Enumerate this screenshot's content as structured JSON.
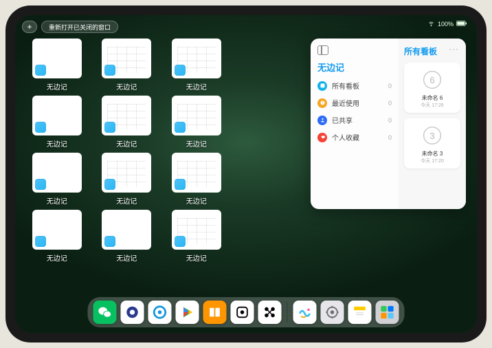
{
  "status": {
    "carrier": "",
    "battery": "100%"
  },
  "top": {
    "plus_label": "+",
    "reopen_label": "重新打开已关闭的窗口"
  },
  "app_label": "无边记",
  "thumbs": [
    {
      "variant": "blank"
    },
    {
      "variant": "cal"
    },
    {
      "variant": "cal"
    },
    null,
    {
      "variant": "blank"
    },
    {
      "variant": "cal"
    },
    {
      "variant": "cal"
    },
    null,
    {
      "variant": "blank"
    },
    {
      "variant": "cal"
    },
    {
      "variant": "cal"
    },
    null,
    {
      "variant": "blank"
    },
    {
      "variant": "blank"
    },
    {
      "variant": "cal"
    }
  ],
  "sidebar": {
    "title": "无边记",
    "items": [
      {
        "label": "所有看板",
        "count": "0",
        "color": "#11b3ec"
      },
      {
        "label": "最近使用",
        "count": "0",
        "color": "#f5a623"
      },
      {
        "label": "已共享",
        "count": "0",
        "color": "#2d6df6"
      },
      {
        "label": "个人收藏",
        "count": "0",
        "color": "#f44336"
      }
    ],
    "right_title": "所有看板",
    "more": "···",
    "boards": [
      {
        "name": "未命名 6",
        "time": "今天 17:26",
        "glyph": "6"
      },
      {
        "name": "未命名 3",
        "time": "今天 17:20",
        "glyph": "3"
      }
    ]
  },
  "dock": [
    {
      "name": "wechat",
      "bg": "#07c160"
    },
    {
      "name": "quark",
      "bg": "#ffffff"
    },
    {
      "name": "qqbrowser",
      "bg": "#ffffff"
    },
    {
      "name": "playstore",
      "bg": "#ffffff"
    },
    {
      "name": "books",
      "bg": "#ff9500"
    },
    {
      "name": "dice",
      "bg": "#ffffff"
    },
    {
      "name": "connect",
      "bg": "#ffffff"
    },
    {
      "name": "freeform",
      "bg": "#ffffff"
    },
    {
      "name": "settings",
      "bg": "#e5e5ea"
    },
    {
      "name": "notes",
      "bg": "#ffffff"
    },
    {
      "name": "folder",
      "bg": "#d0d0d5"
    }
  ]
}
